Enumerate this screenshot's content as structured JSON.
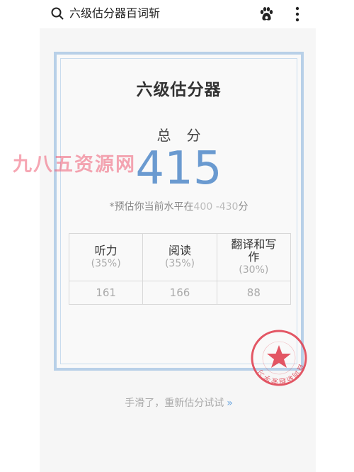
{
  "topbar": {
    "query": "六级估分器百词斩"
  },
  "card": {
    "title": "六级估分器",
    "total_label": "总分",
    "total_score": "415",
    "estimate_prefix": "*预估你当前水平在",
    "estimate_range": "400 -430",
    "estimate_suffix": "分",
    "table": {
      "headers": [
        {
          "label": "听力",
          "weight": "(35%)"
        },
        {
          "label": "阅读",
          "weight": "(35%)"
        },
        {
          "label": "翻译和写作",
          "weight": "(30%)"
        }
      ],
      "values": [
        "161",
        "166",
        "88"
      ]
    },
    "stamp_text": "百词斩超爱学习"
  },
  "retry": {
    "label": "手滑了，重新估分试试",
    "arrows": "»"
  },
  "watermark": "九八五资源网",
  "colors": {
    "accent": "#6a9ad0",
    "card_border": "#b8d0e8",
    "stamp": "#e04050",
    "background": "#f6f6f6"
  }
}
